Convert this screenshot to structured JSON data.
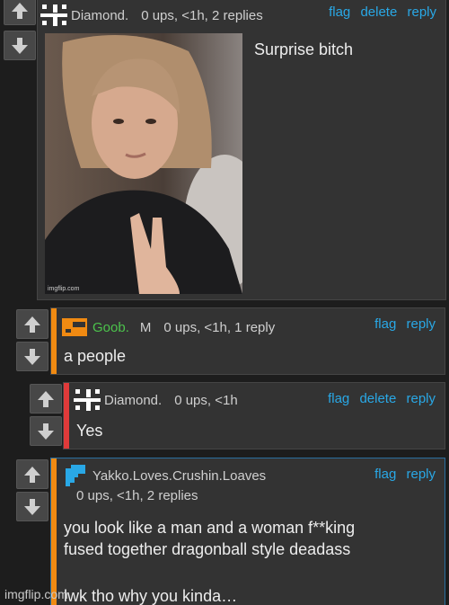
{
  "comments": [
    {
      "username": "Diamond.",
      "meta": "0 ups, <1h, 2 replies",
      "actions": [
        "flag",
        "delete",
        "reply"
      ],
      "text": "Surprise bitch",
      "image_watermark": "imgflip.com"
    },
    {
      "username": "Goob.",
      "flair": "M",
      "meta": "0 ups, <1h, 1 reply",
      "actions": [
        "flag",
        "reply"
      ],
      "text": "a people",
      "accent_color": "#f08a12",
      "username_color": "#4cc34c"
    },
    {
      "username": "Diamond.",
      "meta": "0 ups, <1h",
      "actions": [
        "flag",
        "delete",
        "reply"
      ],
      "text": "Yes",
      "accent_color": "#e03a3a"
    },
    {
      "username": "Yakko.Loves.Crushin.Loaves",
      "meta": "0 ups, <1h, 2 replies",
      "actions": [
        "flag",
        "reply"
      ],
      "text_lines": [
        "you look like a man and a woman f**king",
        "fused together dragonball style deadass",
        "",
        "lwk tho why you kinda…"
      ],
      "accent_color": "#f08a12"
    }
  ],
  "watermark": "imgflip.com",
  "icons": {
    "upvote": "arrow-up-icon",
    "downvote": "arrow-down-icon"
  }
}
